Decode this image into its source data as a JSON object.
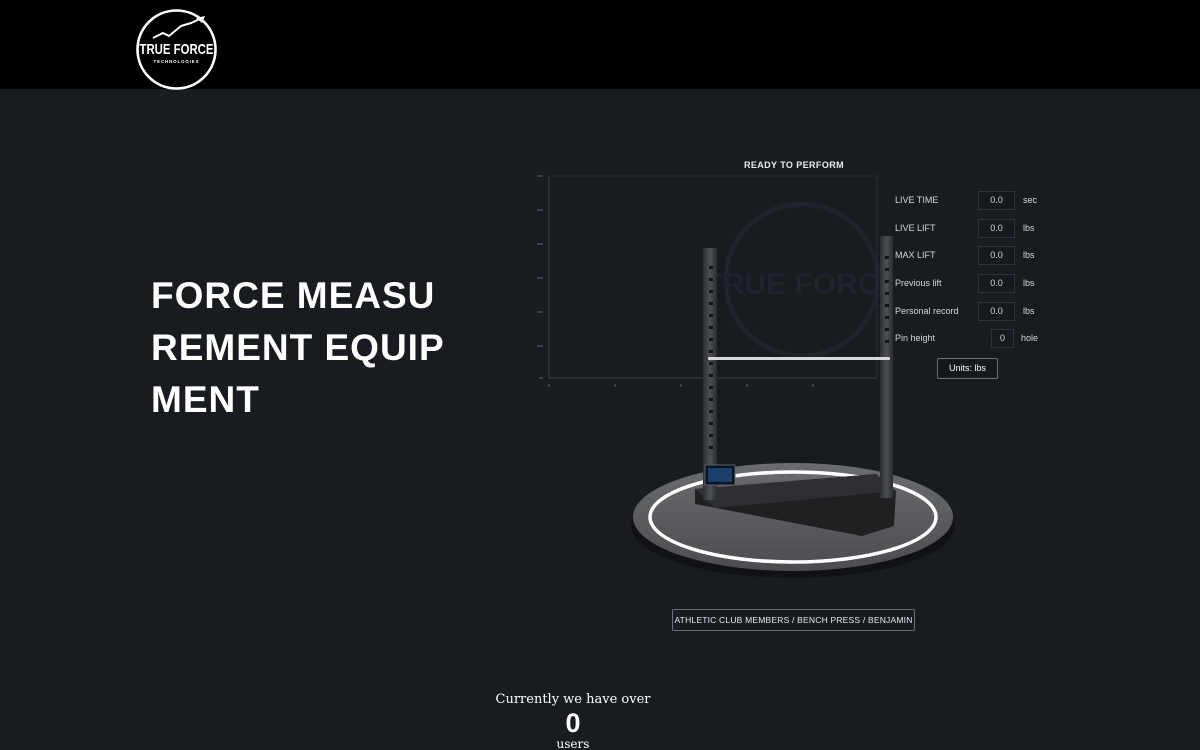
{
  "header": {
    "logo": {
      "title": "TRUE FORCE",
      "subtitle": "TECHNOLOGIES",
      "icon": "rising-arrow-icon"
    }
  },
  "hero": {
    "title": "FORCE MEASUREMENT EQUIPMENT"
  },
  "panel": {
    "status": "READY TO PERFORM",
    "units_button": "Units: lbs",
    "stats": [
      {
        "label": "LIVE TIME",
        "value": "0.0",
        "unit": "sec"
      },
      {
        "label": "LIVE LIFT",
        "value": "0.0",
        "unit": "lbs"
      },
      {
        "label": "MAX LIFT",
        "value": "0.0",
        "unit": "lbs"
      },
      {
        "label": "Previous lift",
        "value": "0.0",
        "unit": "lbs"
      },
      {
        "label": "Personal record",
        "value": "0.0",
        "unit": "lbs"
      },
      {
        "label": "Pin height",
        "value": "0",
        "unit": "hole"
      }
    ],
    "breadcrumb": "ATHLETIC CLUB MEMBERS / BENCH PRESS / BENJAMIN"
  },
  "counter": {
    "intro": "Currently we have over",
    "number": "0",
    "unit": "users"
  },
  "colors": {
    "page_background": "#181b20",
    "header_background": "#000000",
    "text": "#ffffff",
    "platform": "#5f6166",
    "platform_ring": "#ffffff"
  }
}
